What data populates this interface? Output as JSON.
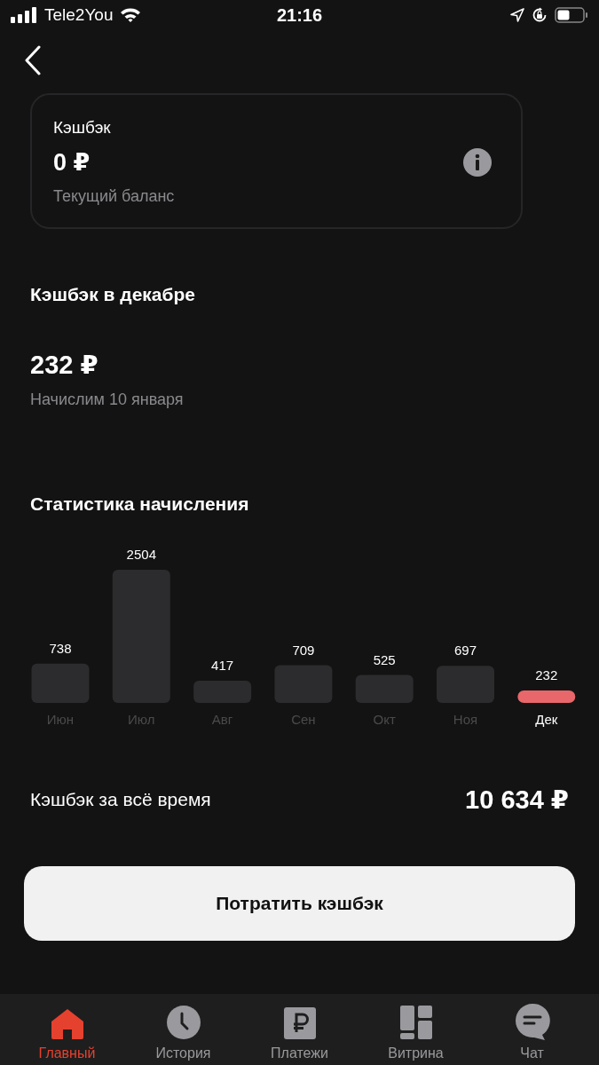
{
  "status_bar": {
    "carrier": "Tele2You",
    "time": "21:16"
  },
  "balance_card": {
    "title": "Кэшбэк",
    "amount": "0 ₽",
    "caption": "Текущий баланс"
  },
  "month_cashback": {
    "title": "Кэшбэк в декабре",
    "amount": "232 ₽",
    "caption": "Начислим 10 января"
  },
  "statistics": {
    "title": "Статистика начисления",
    "chart_data": {
      "type": "bar",
      "categories": [
        "Июн",
        "Июл",
        "Авг",
        "Сен",
        "Окт",
        "Ноя",
        "Дек"
      ],
      "values": [
        738,
        2504,
        417,
        709,
        525,
        697,
        232
      ],
      "data_labels": true
    },
    "bars": [
      {
        "color": "#2c2c2e",
        "selected": false
      },
      {
        "color": "#2c2c2e",
        "selected": false
      },
      {
        "color": "#2c2c2e",
        "selected": false
      },
      {
        "color": "#2c2c2e",
        "selected": false
      },
      {
        "color": "#2c2c2e",
        "selected": false
      },
      {
        "color": "#2c2c2e",
        "selected": false
      },
      {
        "color": "#e8676a",
        "selected": true
      }
    ]
  },
  "total": {
    "label": "Кэшбэк за всё время",
    "amount": "10 634 ₽"
  },
  "spend_button": "Потратить кэшбэк",
  "tab_bar": [
    {
      "kind": "home",
      "label": "Главный",
      "selected": true
    },
    {
      "kind": "history",
      "label": "История",
      "selected": false
    },
    {
      "kind": "payments",
      "label": "Платежи",
      "selected": false
    },
    {
      "kind": "showcase",
      "label": "Витрина",
      "selected": false
    },
    {
      "kind": "chat",
      "label": "Чат",
      "selected": false
    }
  ]
}
